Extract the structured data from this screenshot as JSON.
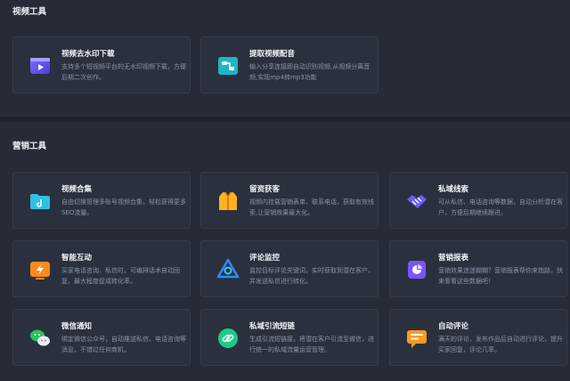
{
  "sections": {
    "video_tools": {
      "title": "视频工具",
      "cards": [
        {
          "title": "视频去水印下载",
          "desc": "支持多个短视频平台的无水印视频下载，方便后期二次创作。",
          "icon": "video-play-icon"
        },
        {
          "title": "提取视频配音",
          "desc": "输入分享连接即自动识别视频,从视频分离音频,实现mp4转mp3功能",
          "icon": "audio-extract-icon"
        }
      ]
    },
    "marketing_tools": {
      "title": "营销工具",
      "cards": [
        {
          "title": "视频合集",
          "desc": "自由切换管理多账号视频合集，轻松获得更多SEO流量。",
          "icon": "folder-icon"
        },
        {
          "title": "留资获客",
          "desc": "视频内挂载营销表单、联系电话，获取有效线索,让营销效果最大化。",
          "icon": "vest-icon"
        },
        {
          "title": "私域线索",
          "desc": "可从私信、电话咨询等数据，自动分析潜在客户，方便后期继续跟进。",
          "icon": "handshake-icon"
        },
        {
          "title": "智能互动",
          "desc": "买家电话咨询、私信时，可编排话术自动回复，最大程度促成转化率。",
          "icon": "lightning-icon"
        },
        {
          "title": "评论监控",
          "desc": "监控目标评论关键词，实时获取到潜在客户，并发送私信进行转化。",
          "icon": "monitor-icon"
        },
        {
          "title": "营销报表",
          "desc": "营销效果迷迷糊糊？营销报表帮你来指路，快来看看这些数据吧！",
          "icon": "report-icon"
        },
        {
          "title": "微信通知",
          "desc": "绑定微信公众号，自动推送私信、电话咨询等消息，不错过任何商机。",
          "icon": "wechat-icon"
        },
        {
          "title": "私域引流短链",
          "desc": "生成引流短链接，将潜在客户引流至微信，进行统一的私域流量运营管理。",
          "icon": "link-icon"
        },
        {
          "title": "自动评论",
          "desc": "满天的评论，发布作品后自动进行评论，提升买家回复，评论几率。",
          "icon": "comment-icon"
        }
      ]
    }
  }
}
